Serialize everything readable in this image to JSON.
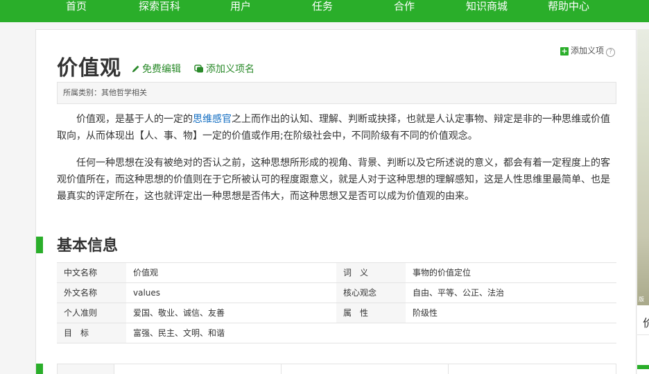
{
  "nav": {
    "items": [
      "首页",
      "探索百科",
      "用户",
      "任务",
      "合作",
      "知识商城",
      "帮助中心"
    ]
  },
  "entry": {
    "title": "价值观",
    "edit_label": "免费编辑",
    "alias_label": "添加义项名",
    "add_item_label": "添加义项",
    "help_glyph": "?",
    "category": "所属类别：其他哲学相关"
  },
  "intro": {
    "p1_before": "价值观，是基于人的一定的",
    "p1_link": "思维感官",
    "p1_after": "之上而作出的认知、理解、判断或抉择，也就是人认定事物、辩定是非的一种思维或价值取向，从而体现出【人、事、物】一定的价值或作用;在阶级社会中，不同阶级有不同的价值观念。",
    "p2": "任何一种思想在没有被绝对的否认之前，这种思想所形成的视角、背景、判断以及它所述说的意义，都会有着一定程度上的客观价值所在，而这种思想的价值则在于它所被认可的程度跟意义，就是人对于这种思想的理解感知，这是人性思维里最简单、也是最真实的评定所在，这也就评定出一种思想是否伟大，而这种思想又是否可以成为价值观的由来。"
  },
  "basic_info": {
    "heading": "基本信息",
    "rows": [
      {
        "k1": "中文名称",
        "v1": "价值观",
        "k2": "词　义",
        "v2": "事物的价值定位"
      },
      {
        "k1": "外文名称",
        "v1": "values",
        "k2": "核心观念",
        "v2": "自由、平等、公正、法治"
      },
      {
        "k1": "个人准则",
        "v1": "爱国、敬业、诚信、友善",
        "k2": "属　性",
        "v2": "阶级性"
      },
      {
        "k1": "目　标",
        "v1": "富强、民主、文明、和谐",
        "k2": "",
        "v2": ""
      }
    ]
  },
  "side": {
    "photo_caption": "版",
    "partial_text": "价"
  },
  "colors": {
    "brand_green": "#2aae2a",
    "link_blue": "#136ec2",
    "action_green": "#2a8a2a"
  }
}
